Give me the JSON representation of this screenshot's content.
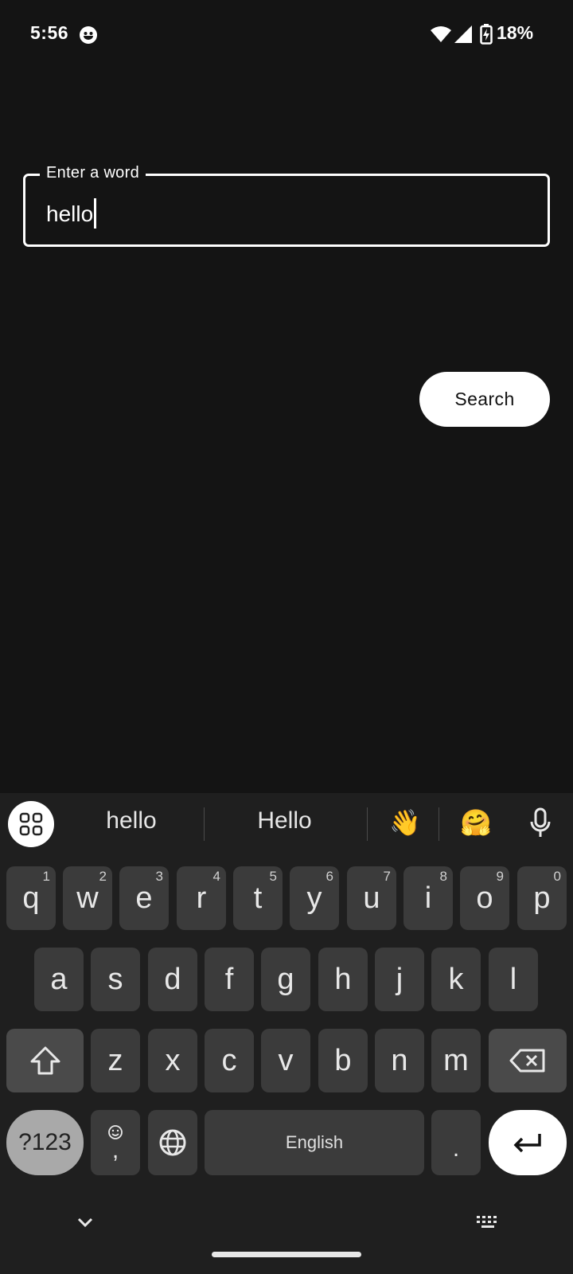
{
  "status_bar": {
    "time": "5:56",
    "battery": "18%"
  },
  "field": {
    "label": "Enter a word",
    "value": "hello"
  },
  "search_button": {
    "label": "Search"
  },
  "keyboard": {
    "suggestions": [
      "hello",
      "Hello"
    ],
    "emoji_suggestions": [
      "👋",
      "🤗"
    ],
    "row1": [
      {
        "key": "q",
        "hint": "1"
      },
      {
        "key": "w",
        "hint": "2"
      },
      {
        "key": "e",
        "hint": "3"
      },
      {
        "key": "r",
        "hint": "4"
      },
      {
        "key": "t",
        "hint": "5"
      },
      {
        "key": "y",
        "hint": "6"
      },
      {
        "key": "u",
        "hint": "7"
      },
      {
        "key": "i",
        "hint": "8"
      },
      {
        "key": "o",
        "hint": "9"
      },
      {
        "key": "p",
        "hint": "0"
      }
    ],
    "row2": [
      "a",
      "s",
      "d",
      "f",
      "g",
      "h",
      "j",
      "k",
      "l"
    ],
    "row3": [
      "z",
      "x",
      "c",
      "v",
      "b",
      "n",
      "m"
    ],
    "symbols_label": "?123",
    "comma_label": ",",
    "space_label": "English",
    "period_label": "."
  }
}
